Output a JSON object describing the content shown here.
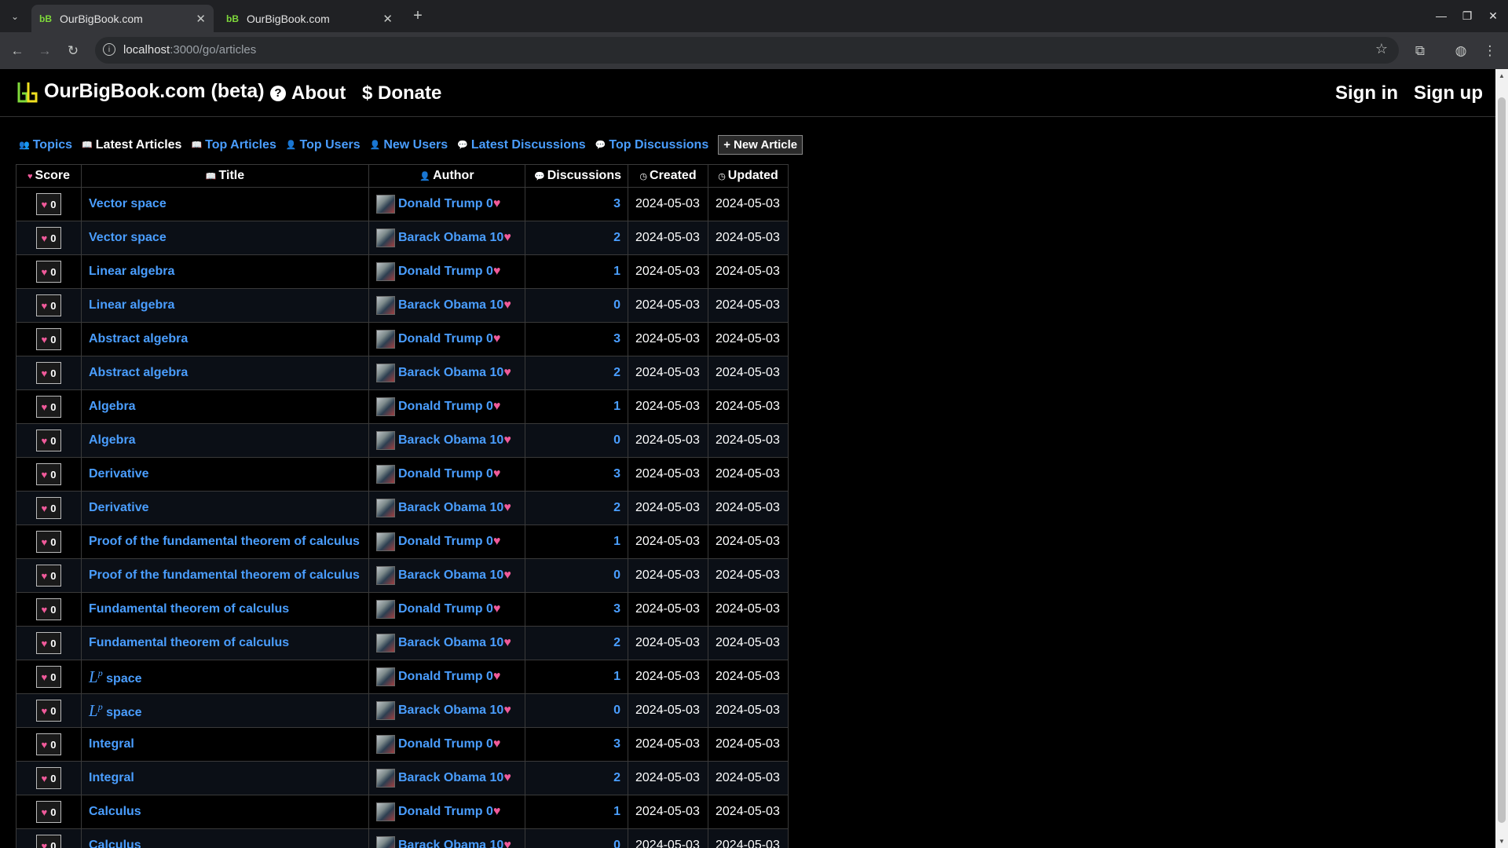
{
  "browser": {
    "tabs": [
      {
        "title": "OurBigBook.com",
        "active": true
      },
      {
        "title": "OurBigBook.com",
        "active": false
      }
    ],
    "url_host": "localhost",
    "url_path": ":3000/go/articles"
  },
  "header": {
    "brand": "OurBigBook.com (beta)",
    "about": "About",
    "donate": "$ Donate",
    "sign_in": "Sign in",
    "sign_up": "Sign up"
  },
  "tabs": {
    "topics": "Topics",
    "latest_articles": "Latest Articles",
    "top_articles": "Top Articles",
    "top_users": "Top Users",
    "new_users": "New Users",
    "latest_discussions": "Latest Discussions",
    "top_discussions": "Top Discussions",
    "new_article": "New Article"
  },
  "table": {
    "headers": {
      "score": "Score",
      "title": "Title",
      "author": "Author",
      "discussions": "Discussions",
      "created": "Created",
      "updated": "Updated"
    },
    "rows": [
      {
        "score": "0",
        "title": "Vector space",
        "author": "Donald Trump 0",
        "discussions": "3",
        "created": "2024-05-03",
        "updated": "2024-05-03"
      },
      {
        "score": "0",
        "title": "Vector space",
        "author": "Barack Obama 10",
        "discussions": "2",
        "created": "2024-05-03",
        "updated": "2024-05-03"
      },
      {
        "score": "0",
        "title": "Linear algebra",
        "author": "Donald Trump 0",
        "discussions": "1",
        "created": "2024-05-03",
        "updated": "2024-05-03"
      },
      {
        "score": "0",
        "title": "Linear algebra",
        "author": "Barack Obama 10",
        "discussions": "0",
        "created": "2024-05-03",
        "updated": "2024-05-03"
      },
      {
        "score": "0",
        "title": "Abstract algebra",
        "author": "Donald Trump 0",
        "discussions": "3",
        "created": "2024-05-03",
        "updated": "2024-05-03"
      },
      {
        "score": "0",
        "title": "Abstract algebra",
        "author": "Barack Obama 10",
        "discussions": "2",
        "created": "2024-05-03",
        "updated": "2024-05-03"
      },
      {
        "score": "0",
        "title": "Algebra",
        "author": "Donald Trump 0",
        "discussions": "1",
        "created": "2024-05-03",
        "updated": "2024-05-03"
      },
      {
        "score": "0",
        "title": "Algebra",
        "author": "Barack Obama 10",
        "discussions": "0",
        "created": "2024-05-03",
        "updated": "2024-05-03"
      },
      {
        "score": "0",
        "title": "Derivative",
        "author": "Donald Trump 0",
        "discussions": "3",
        "created": "2024-05-03",
        "updated": "2024-05-03"
      },
      {
        "score": "0",
        "title": "Derivative",
        "author": "Barack Obama 10",
        "discussions": "2",
        "created": "2024-05-03",
        "updated": "2024-05-03"
      },
      {
        "score": "0",
        "title": "Proof of the fundamental theorem of calculus",
        "author": "Donald Trump 0",
        "discussions": "1",
        "created": "2024-05-03",
        "updated": "2024-05-03"
      },
      {
        "score": "0",
        "title": "Proof of the fundamental theorem of calculus",
        "author": "Barack Obama 10",
        "discussions": "0",
        "created": "2024-05-03",
        "updated": "2024-05-03"
      },
      {
        "score": "0",
        "title": "Fundamental theorem of calculus",
        "author": "Donald Trump 0",
        "discussions": "3",
        "created": "2024-05-03",
        "updated": "2024-05-03"
      },
      {
        "score": "0",
        "title": "Fundamental theorem of calculus",
        "author": "Barack Obama 10",
        "discussions": "2",
        "created": "2024-05-03",
        "updated": "2024-05-03"
      },
      {
        "score": "0",
        "title": "space",
        "math": "L",
        "math_sup": "p",
        "author": "Donald Trump 0",
        "discussions": "1",
        "created": "2024-05-03",
        "updated": "2024-05-03"
      },
      {
        "score": "0",
        "title": "space",
        "math": "L",
        "math_sup": "p",
        "author": "Barack Obama 10",
        "discussions": "0",
        "created": "2024-05-03",
        "updated": "2024-05-03"
      },
      {
        "score": "0",
        "title": "Integral",
        "author": "Donald Trump 0",
        "discussions": "3",
        "created": "2024-05-03",
        "updated": "2024-05-03"
      },
      {
        "score": "0",
        "title": "Integral",
        "author": "Barack Obama 10",
        "discussions": "2",
        "created": "2024-05-03",
        "updated": "2024-05-03"
      },
      {
        "score": "0",
        "title": "Calculus",
        "author": "Donald Trump 0",
        "discussions": "1",
        "created": "2024-05-03",
        "updated": "2024-05-03"
      },
      {
        "score": "0",
        "title": "Calculus",
        "author": "Barack Obama 10",
        "discussions": "0",
        "created": "2024-05-03",
        "updated": "2024-05-03"
      }
    ]
  },
  "colors": {
    "link": "#4a9eff",
    "heart": "#f05a9a",
    "background": "#000000"
  }
}
